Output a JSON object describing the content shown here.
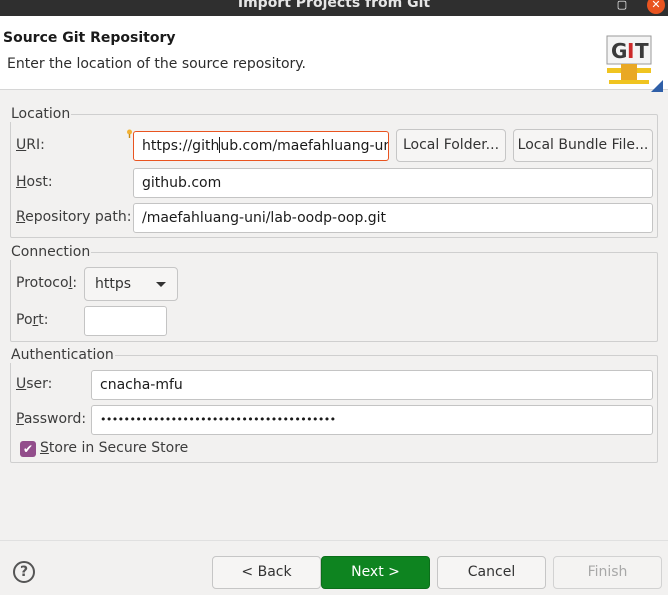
{
  "window": {
    "title": "Import Projects from Git"
  },
  "header": {
    "title": "Source Git Repository",
    "description": "Enter the location of the source repository.",
    "logo_text": "GIT"
  },
  "location": {
    "legend": "Location",
    "uri": {
      "label_u": "U",
      "label_rest": "RI:",
      "value_before_caret": "https://gith",
      "value_after_caret": "ub.com/maefahluang-un"
    },
    "local_folder_button": "Local Folder...",
    "local_bundle_button": "Local Bundle File...",
    "host": {
      "label_u": "H",
      "label_rest": "ost:",
      "value": "github.com"
    },
    "repo_path": {
      "label_u": "R",
      "label_rest": "epository path:",
      "value": "/maefahluang-uni/lab-oodp-oop.git"
    }
  },
  "connection": {
    "legend": "Connection",
    "protocol": {
      "label_pre": "Protoco",
      "label_u": "l",
      "label_post": ":",
      "value": "https"
    },
    "port": {
      "label_pre": "Po",
      "label_u": "r",
      "label_post": "t:",
      "value": ""
    }
  },
  "authentication": {
    "legend": "Authentication",
    "user": {
      "label_u": "U",
      "label_rest": "ser:",
      "value": "cnacha-mfu"
    },
    "password": {
      "label_u": "P",
      "label_rest": "assword:",
      "value": "••••••••••••••••••••••••••••••••••••••••"
    },
    "store": {
      "label_u": "S",
      "label_rest": "tore in Secure Store",
      "checked": true
    }
  },
  "footer": {
    "help": "?",
    "back": "< Back",
    "next": "Next >",
    "cancel": "Cancel",
    "finish": "Finish"
  },
  "colors": {
    "accent": "#e95420",
    "primary_button": "#0e8420",
    "checkbox": "#924d8b"
  }
}
